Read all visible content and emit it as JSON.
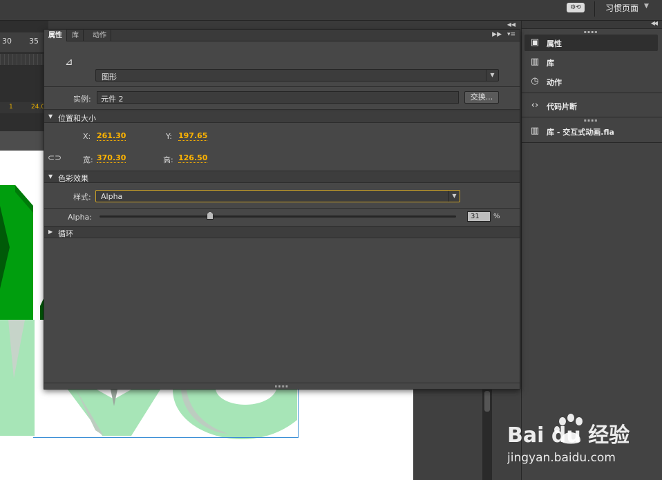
{
  "app_bar": {
    "workspace_label": "习惯页面",
    "sync_icon": "sync-settings-icon",
    "caret_icon": "chevron-down-icon"
  },
  "timeline": {
    "ruler": [
      "30",
      "35"
    ],
    "status": [
      "1",
      "24.0"
    ]
  },
  "properties_panel": {
    "tabs": [
      {
        "label": "属性"
      },
      {
        "label": "库"
      },
      {
        "label": "动作"
      }
    ],
    "symbol_type": "图形",
    "instance": {
      "label": "实例:",
      "value": "元件 2",
      "swap_button": "交换..."
    },
    "position_size": {
      "title": "位置和大小",
      "x_label": "X:",
      "x": "261.30",
      "y_label": "Y:",
      "y": "197.65",
      "w_label": "宽:",
      "w": "370.30",
      "h_label": "高:",
      "h": "126.50"
    },
    "color_effect": {
      "title": "色彩效果",
      "style_label": "样式:",
      "style_value": "Alpha",
      "alpha_label": "Alpha:",
      "alpha_value": "31",
      "alpha_fraction": 0.31,
      "percent_sign": "%"
    },
    "loop": {
      "title": "循环"
    }
  },
  "dock": {
    "items": [
      {
        "label": "属性",
        "icon": "properties-icon"
      },
      {
        "label": "库",
        "icon": "library-icon"
      },
      {
        "label": "动作",
        "icon": "actions-icon"
      },
      {
        "label": "代码片断",
        "icon": "code-snippets-icon"
      },
      {
        "label": "库 - 交互式动画.fla",
        "icon": "library-icon"
      }
    ]
  },
  "watermark": {
    "brand": "Bai du 经验",
    "url": "jingyan.baidu.com"
  },
  "colors": {
    "accent_orange": "#ffb400",
    "green_dark": "#009e0e",
    "green_light": "#a7e5b7"
  }
}
